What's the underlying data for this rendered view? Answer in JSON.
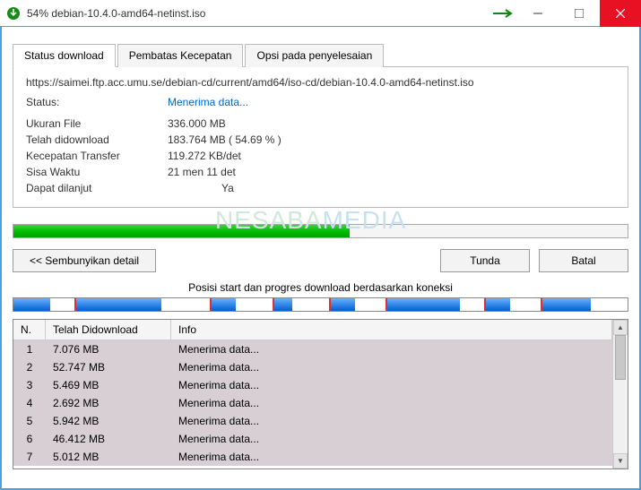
{
  "window": {
    "title": "54% debian-10.4.0-amd64-netinst.iso"
  },
  "tabs": {
    "t0": "Status download",
    "t1": "Pembatas Kecepatan",
    "t2": "Opsi pada penyelesaian"
  },
  "download": {
    "url": "https://saimei.ftp.acc.umu.se/debian-cd/current/amd64/iso-cd/debian-10.4.0-amd64-netinst.iso",
    "status_label": "Status:",
    "status_value": "Menerima data...",
    "filesize_label": "Ukuran File",
    "filesize_value": "336.000   MB",
    "downloaded_label": "Telah didownload",
    "downloaded_value": "183.764   MB   ( 54.69 % )",
    "speed_label": "Kecepatan Transfer",
    "speed_value": "119.272   KB/det",
    "timeleft_label": "Sisa Waktu",
    "timeleft_value": "21 men 11 det",
    "resume_label": "Dapat dilanjut",
    "resume_value": "Ya"
  },
  "buttons": {
    "hide": "<< Sembunyikan detail",
    "pause": "Tunda",
    "cancel": "Batal"
  },
  "sections": {
    "pos_label": "Posisi start dan progres download berdasarkan koneksi"
  },
  "grid": {
    "h_n": "N.",
    "h_d": "Telah Didownload",
    "h_i": "Info",
    "rows": [
      {
        "n": "1",
        "d": "7.076   MB",
        "i": "Menerima data..."
      },
      {
        "n": "2",
        "d": "52.747   MB",
        "i": "Menerima data..."
      },
      {
        "n": "3",
        "d": "5.469   MB",
        "i": "Menerima data..."
      },
      {
        "n": "4",
        "d": "2.692   MB",
        "i": "Menerima data..."
      },
      {
        "n": "5",
        "d": "5.942   MB",
        "i": "Menerima data..."
      },
      {
        "n": "6",
        "d": "46.412   MB",
        "i": "Menerima data..."
      },
      {
        "n": "7",
        "d": "5.012   MB",
        "i": "Menerima data..."
      }
    ]
  },
  "watermark": {
    "a": "NESABA",
    "b": "MEDIA"
  }
}
